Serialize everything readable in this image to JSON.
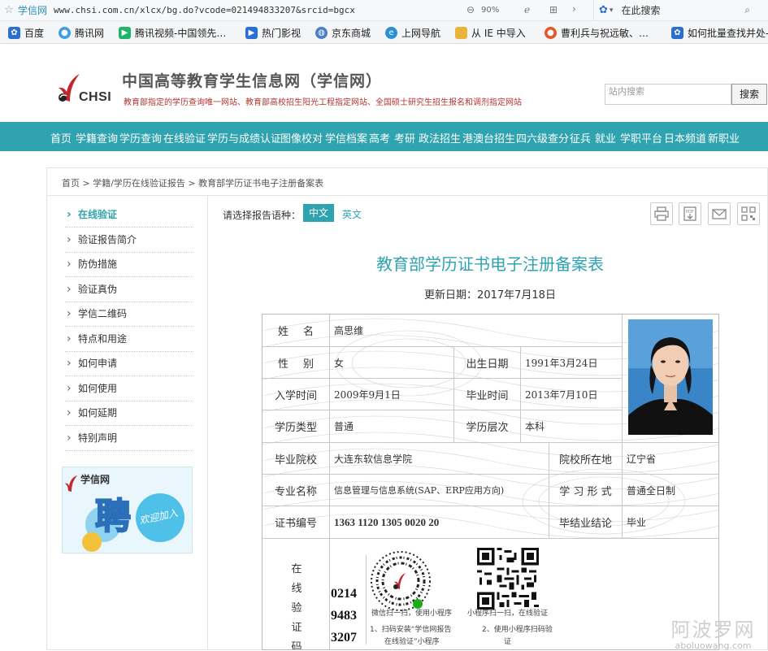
{
  "browser": {
    "site_name": "学信网",
    "url": "www.chsi.com.cn/xlcx/bg.do?vcode=021494833207&srcid=bgcx",
    "zoom": "90%",
    "search_label": "在此搜索"
  },
  "favorites": [
    {
      "label": "百度",
      "icon": "baidu-paw-icon",
      "color": "#2a6fd6"
    },
    {
      "label": "腾讯网",
      "icon": "tencent-icon",
      "color": "#3c9ee5"
    },
    {
      "label": "腾讯视频-中国领先…",
      "icon": "tencent-video-icon",
      "color": "#1fb46c"
    },
    {
      "label": "热门影视",
      "icon": "play-icon",
      "color": "#2a6fd6"
    },
    {
      "label": "京东商城",
      "icon": "globe-icon",
      "color": "#4a7fc0"
    },
    {
      "label": "上网导航",
      "icon": "ie-icon",
      "color": "#2a8fd6"
    },
    {
      "label": "从 IE 中导入",
      "icon": "folder-icon",
      "color": "#e8b53a"
    },
    {
      "label": "曹利兵与祝远敏、…",
      "icon": "fire-icon",
      "color": "#e05a2a"
    },
    {
      "label": "如何批量查找并处-…",
      "icon": "baidu-paw-icon",
      "color": "#2a6fd6"
    }
  ],
  "header": {
    "logo_text": "CHSI",
    "title": "中国高等教育学生信息网（学信网）",
    "subtitle": "教育部指定的学历查询唯一网站、教育部高校招生阳光工程指定网站、全国硕士研究生招生报名和调剂指定网站",
    "search_placeholder": "站内搜索",
    "search_button": "搜索"
  },
  "nav": [
    "首页",
    "学籍查询",
    "学历查询",
    "在线验证",
    "学历与成绩认证",
    "图像校对",
    "学信档案",
    "高考",
    "考研",
    "政法招生",
    "港澳台招生",
    "四六级查分",
    "征兵",
    "就业",
    "学职平台",
    "日本频道",
    "新职业"
  ],
  "breadcrumb": "首页 > 学籍/学历在线验证报告 > 教育部学历证书电子注册备案表",
  "sidebar": [
    "在线验证",
    "验证报告简介",
    "防伪措施",
    "验证真伪",
    "学信二维码",
    "特点和用途",
    "如何申请",
    "如何使用",
    "如何延期",
    "特别声明"
  ],
  "recruit_banner": {
    "brand": "学信网",
    "big": "聘",
    "tag": "欢迎加入"
  },
  "language": {
    "label": "请选择报告语种：",
    "zh": "中文",
    "en": "英文"
  },
  "tools": [
    "print-icon",
    "pdf-download-icon",
    "email-icon",
    "qrcode-icon"
  ],
  "document": {
    "title": "教育部学历证书电子注册备案表",
    "updated": "更新日期：2017年7月18日"
  },
  "record": {
    "labels": {
      "name": "姓名",
      "gender": "性别",
      "birth": "出生日期",
      "enroll": "入学时间",
      "graduate": "毕业时间",
      "edu_type": "学历类型",
      "edu_level": "学历层次",
      "school": "毕业院校",
      "location": "院校所在地",
      "major": "专业名称",
      "study_form": "学 习 形 式",
      "cert_no": "证书编号",
      "conclusion": "毕结业结论",
      "verify": "在线验证码"
    },
    "values": {
      "name": "高思维",
      "gender": "女",
      "birth": "1991年3月24日",
      "enroll": "2009年9月1日",
      "graduate": "2013年7月10日",
      "edu_type": "普通",
      "edu_level": "本科",
      "school": "大连东软信息学院",
      "location": "辽宁省",
      "major": "信息管理与信息系统(SAP、ERP应用方向)",
      "study_form": "普通全日制",
      "cert_no": "1363 1120 1305 0020 20",
      "conclusion": "毕业"
    },
    "verify_code_lines": [
      "0214",
      "9483",
      "3207"
    ],
    "verify_captions": {
      "wechat": "微信扫一扫，使用小程序",
      "mini": "小程序扫一扫，在线验证",
      "step1a": "1、扫码安装“学信网报告",
      "step1b": "在线验证”小程序",
      "step2a": "2、使用小程序扫码验",
      "step2b": "证"
    }
  },
  "watermark": {
    "main": "阿波罗网",
    "sub": "aboluowang.com"
  }
}
